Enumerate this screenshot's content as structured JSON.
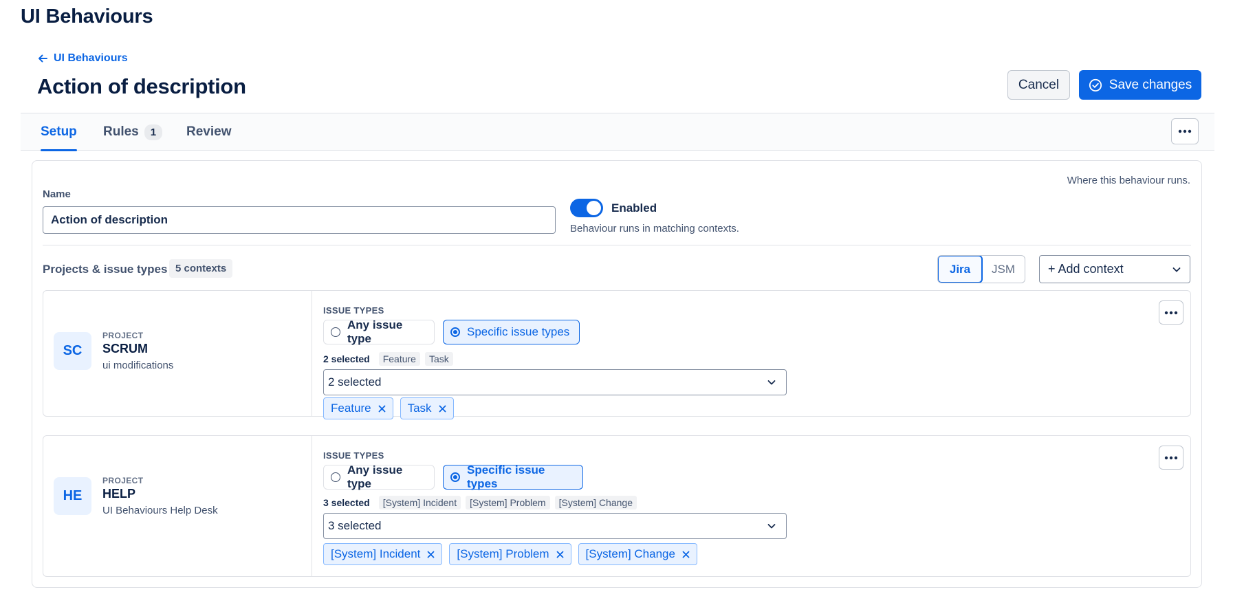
{
  "app": {
    "title": "UI Behaviours"
  },
  "breadcrumb": {
    "back_label": "UI Behaviours"
  },
  "page": {
    "title": "Action of description"
  },
  "actions": {
    "cancel_label": "Cancel",
    "save_label": "Save changes"
  },
  "tabs": [
    {
      "label": "Setup",
      "active": true
    },
    {
      "label": "Rules",
      "count": "1"
    },
    {
      "label": "Review"
    }
  ],
  "setup": {
    "hint": "Where this behaviour runs.",
    "name_label": "Name",
    "name_value": "Action of description",
    "enabled_label": "Enabled",
    "enabled_desc": "Behaviour runs in matching contexts.",
    "enabled": true,
    "projects_label": "Projects & issue types",
    "contexts_badge": "5 contexts",
    "source_options": [
      "Jira",
      "JSM"
    ],
    "source_selected": "Jira",
    "add_context_label": "+ Add context"
  },
  "contexts": [
    {
      "avatar": "SC",
      "kicker": "PROJECT",
      "key": "SCRUM",
      "name": "ui modifications",
      "issue_types_label": "ISSUE TYPES",
      "any_label": "Any issue type",
      "specific_label": "Specific issue types",
      "mode": "specific",
      "selected_count": "2 selected",
      "selected_pills": [
        "Feature",
        "Task"
      ],
      "dropdown_value": "2 selected",
      "chips": [
        "Feature",
        "Task"
      ]
    },
    {
      "avatar": "HE",
      "kicker": "PROJECT",
      "key": "HELP",
      "name": "UI Behaviours Help Desk",
      "issue_types_label": "ISSUE TYPES",
      "any_label": "Any issue type",
      "specific_label": "Specific issue types",
      "mode": "specific",
      "selected_count": "3 selected",
      "selected_pills": [
        "[System] Incident",
        "[System] Problem",
        "[System] Change"
      ],
      "dropdown_value": "3 selected",
      "chips": [
        "[System] Incident",
        "[System] Problem",
        "[System] Change"
      ]
    }
  ],
  "colors": {
    "accent": "#0c66e4",
    "accent_soft": "#e9f2ff",
    "border": "#dfe1e6"
  },
  "icons": {
    "back": "arrow-left-icon",
    "save": "check-circle-icon",
    "more": "more-horizontal-icon",
    "chevron": "chevron-down-icon",
    "remove": "close-icon"
  }
}
